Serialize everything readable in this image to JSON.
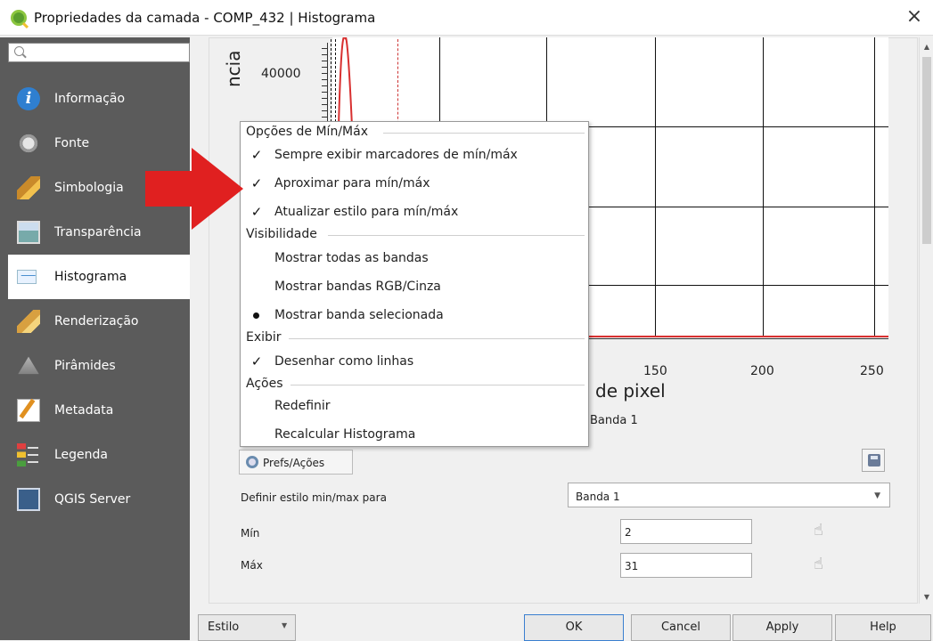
{
  "window": {
    "title": "Propriedades da camada - COMP_432 | Histograma",
    "close_label": "×"
  },
  "sidebar": {
    "search_placeholder": "",
    "items": [
      {
        "label": "Informação",
        "icon": "info-icon"
      },
      {
        "label": "Fonte",
        "icon": "source-icon"
      },
      {
        "label": "Simbologia",
        "icon": "symbology-icon"
      },
      {
        "label": "Transparência",
        "icon": "transparency-icon"
      },
      {
        "label": "Histograma",
        "icon": "histogram-icon",
        "active": true
      },
      {
        "label": "Renderização",
        "icon": "rendering-icon"
      },
      {
        "label": "Pirâmides",
        "icon": "pyramids-icon"
      },
      {
        "label": "Metadata",
        "icon": "metadata-icon"
      },
      {
        "label": "Legenda",
        "icon": "legend-icon"
      },
      {
        "label": "QGIS Server",
        "icon": "qgis-server-icon"
      }
    ]
  },
  "histogram": {
    "y_tick": "40000",
    "y_label": "ncia",
    "x_ticks": [
      "150",
      "200",
      "250"
    ],
    "x_label": "de pixel",
    "legend": "Banda 1",
    "colors": {
      "curve": "#d83030",
      "grid": "#111111"
    }
  },
  "menu": {
    "minmax_header": "Opções de Mín/Máx",
    "minmax_items": [
      {
        "label": "Sempre exibir marcadores de mín/máx",
        "checked": true
      },
      {
        "label": "Aproximar para mín/máx",
        "checked": true
      },
      {
        "label": "Atualizar estilo para mín/máx",
        "checked": true
      }
    ],
    "visibility_header": "Visibilidade",
    "visibility_items": [
      {
        "label": "Mostrar todas as bandas",
        "selected": false
      },
      {
        "label": "Mostrar bandas RGB/Cinza",
        "selected": false
      },
      {
        "label": "Mostrar banda selecionada",
        "selected": true
      }
    ],
    "display_header": "Exibir",
    "display_items": [
      {
        "label": "Desenhar como linhas",
        "checked": true
      }
    ],
    "actions_header": "Ações",
    "action_items": [
      {
        "label": "Redefinir"
      },
      {
        "label": "Recalcular Histograma"
      }
    ],
    "check_glyph": "✓"
  },
  "controls": {
    "prefs_button": "Prefs/Ações",
    "set_style_label": "Definir estilo min/max para",
    "band_select": "Banda 1",
    "band_arrow": "▼",
    "min_label": "Mín",
    "min_value": "2",
    "max_label": "Máx",
    "max_value": "31"
  },
  "footer": {
    "estilo": "Estilo",
    "estilo_arrow": "▼",
    "ok": "OK",
    "cancel": "Cancel",
    "apply": "Apply",
    "help": "Help"
  },
  "scrollbar": {
    "up": "▲",
    "down": "▼"
  }
}
